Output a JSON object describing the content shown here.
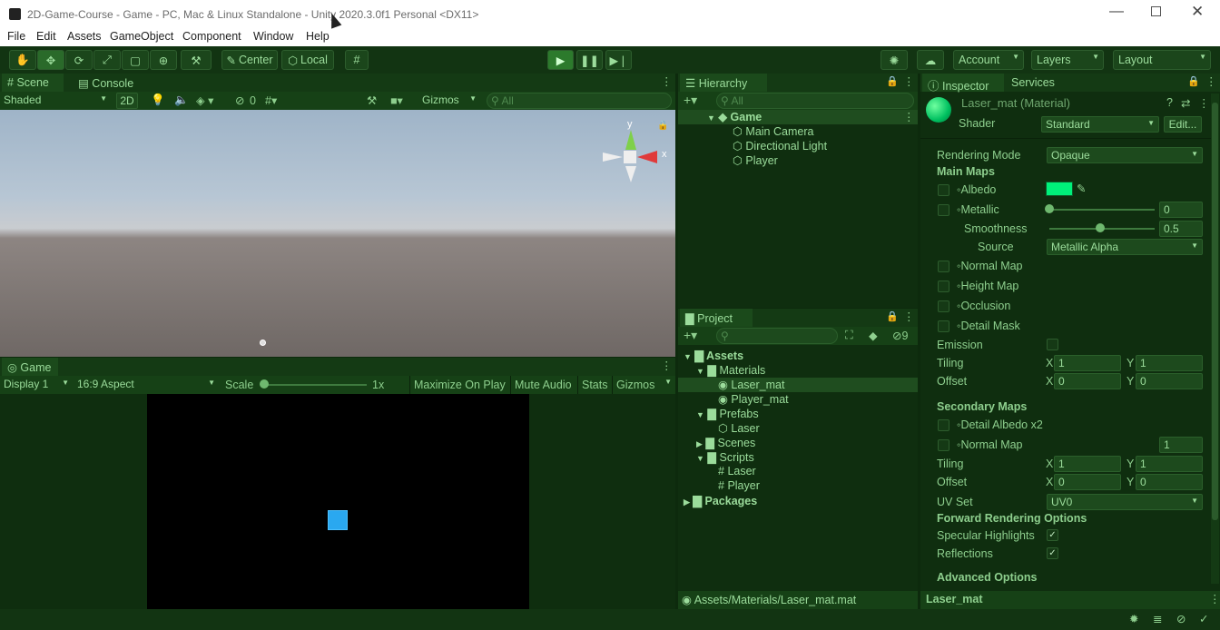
{
  "window": {
    "title": "2D-Game-Course - Game - PC, Mac & Linux Standalone - Unity 2020.3.0f1 Personal <DX11>"
  },
  "menu": [
    "File",
    "Edit",
    "Assets",
    "GameObject",
    "Component",
    "Window",
    "Help"
  ],
  "toolbar": {
    "pivot_label": "Center",
    "space_label": "Local",
    "account_label": "Account",
    "layers_label": "Layers",
    "layout_label": "Layout"
  },
  "scene": {
    "tab_scene": "Scene",
    "tab_console": "Console",
    "shading": "Shaded",
    "mode_2d": "2D",
    "hidden_count": "0",
    "gizmos": "Gizmos",
    "search_placeholder": "All",
    "axis_y": "y",
    "axis_x": "x"
  },
  "game": {
    "tab": "Game",
    "display": "Display 1",
    "aspect": "16:9 Aspect",
    "scale_label": "Scale",
    "scale_value": "1x",
    "maximize": "Maximize On Play",
    "mute": "Mute Audio",
    "stats": "Stats",
    "gizmos": "Gizmos"
  },
  "hierarchy": {
    "tab": "Hierarchy",
    "search_placeholder": "All",
    "root": "Game",
    "items": [
      "Main Camera",
      "Directional Light",
      "Player"
    ]
  },
  "project": {
    "tab": "Project",
    "hidden_count": "9",
    "tree": {
      "assets": "Assets",
      "materials": "Materials",
      "laser_mat": "Laser_mat",
      "player_mat": "Player_mat",
      "prefabs": "Prefabs",
      "laser_prefab": "Laser",
      "scenes": "Scenes",
      "scripts": "Scripts",
      "laser_script": "Laser",
      "player_script": "Player",
      "packages": "Packages"
    },
    "footer_path": "Assets/Materials/Laser_mat.mat"
  },
  "inspector": {
    "tab_inspector": "Inspector",
    "tab_services": "Services",
    "material_name": "Laser_mat (Material)",
    "shader_label": "Shader",
    "shader_value": "Standard",
    "edit_button": "Edit...",
    "rendering_mode_label": "Rendering Mode",
    "rendering_mode_value": "Opaque",
    "main_maps": "Main Maps",
    "albedo": "Albedo",
    "albedo_color": "#00f07a",
    "metallic": "Metallic",
    "metallic_value": "0",
    "smoothness": "Smoothness",
    "smoothness_value": "0.5",
    "source": "Source",
    "source_value": "Metallic Alpha",
    "normal_map": "Normal Map",
    "height_map": "Height Map",
    "occlusion": "Occlusion",
    "detail_mask": "Detail Mask",
    "emission": "Emission",
    "tiling": "Tiling",
    "offset": "Offset",
    "x": "X",
    "y": "Y",
    "tiling_x": "1",
    "tiling_y": "1",
    "offset_x": "0",
    "offset_y": "0",
    "secondary_maps": "Secondary Maps",
    "detail_albedo": "Detail Albedo x2",
    "normal_map2": "Normal Map",
    "normal_map2_value": "1",
    "tiling2_x": "1",
    "tiling2_y": "1",
    "offset2_x": "0",
    "offset2_y": "0",
    "uv_set": "UV Set",
    "uv_set_value": "UV0",
    "forward_rendering": "Forward Rendering Options",
    "specular": "Specular Highlights",
    "reflections": "Reflections",
    "advanced": "Advanced Options",
    "footer_name": "Laser_mat"
  },
  "colors": {
    "accent": "#8ecf8e",
    "game_cube": "#2aa8f0"
  }
}
